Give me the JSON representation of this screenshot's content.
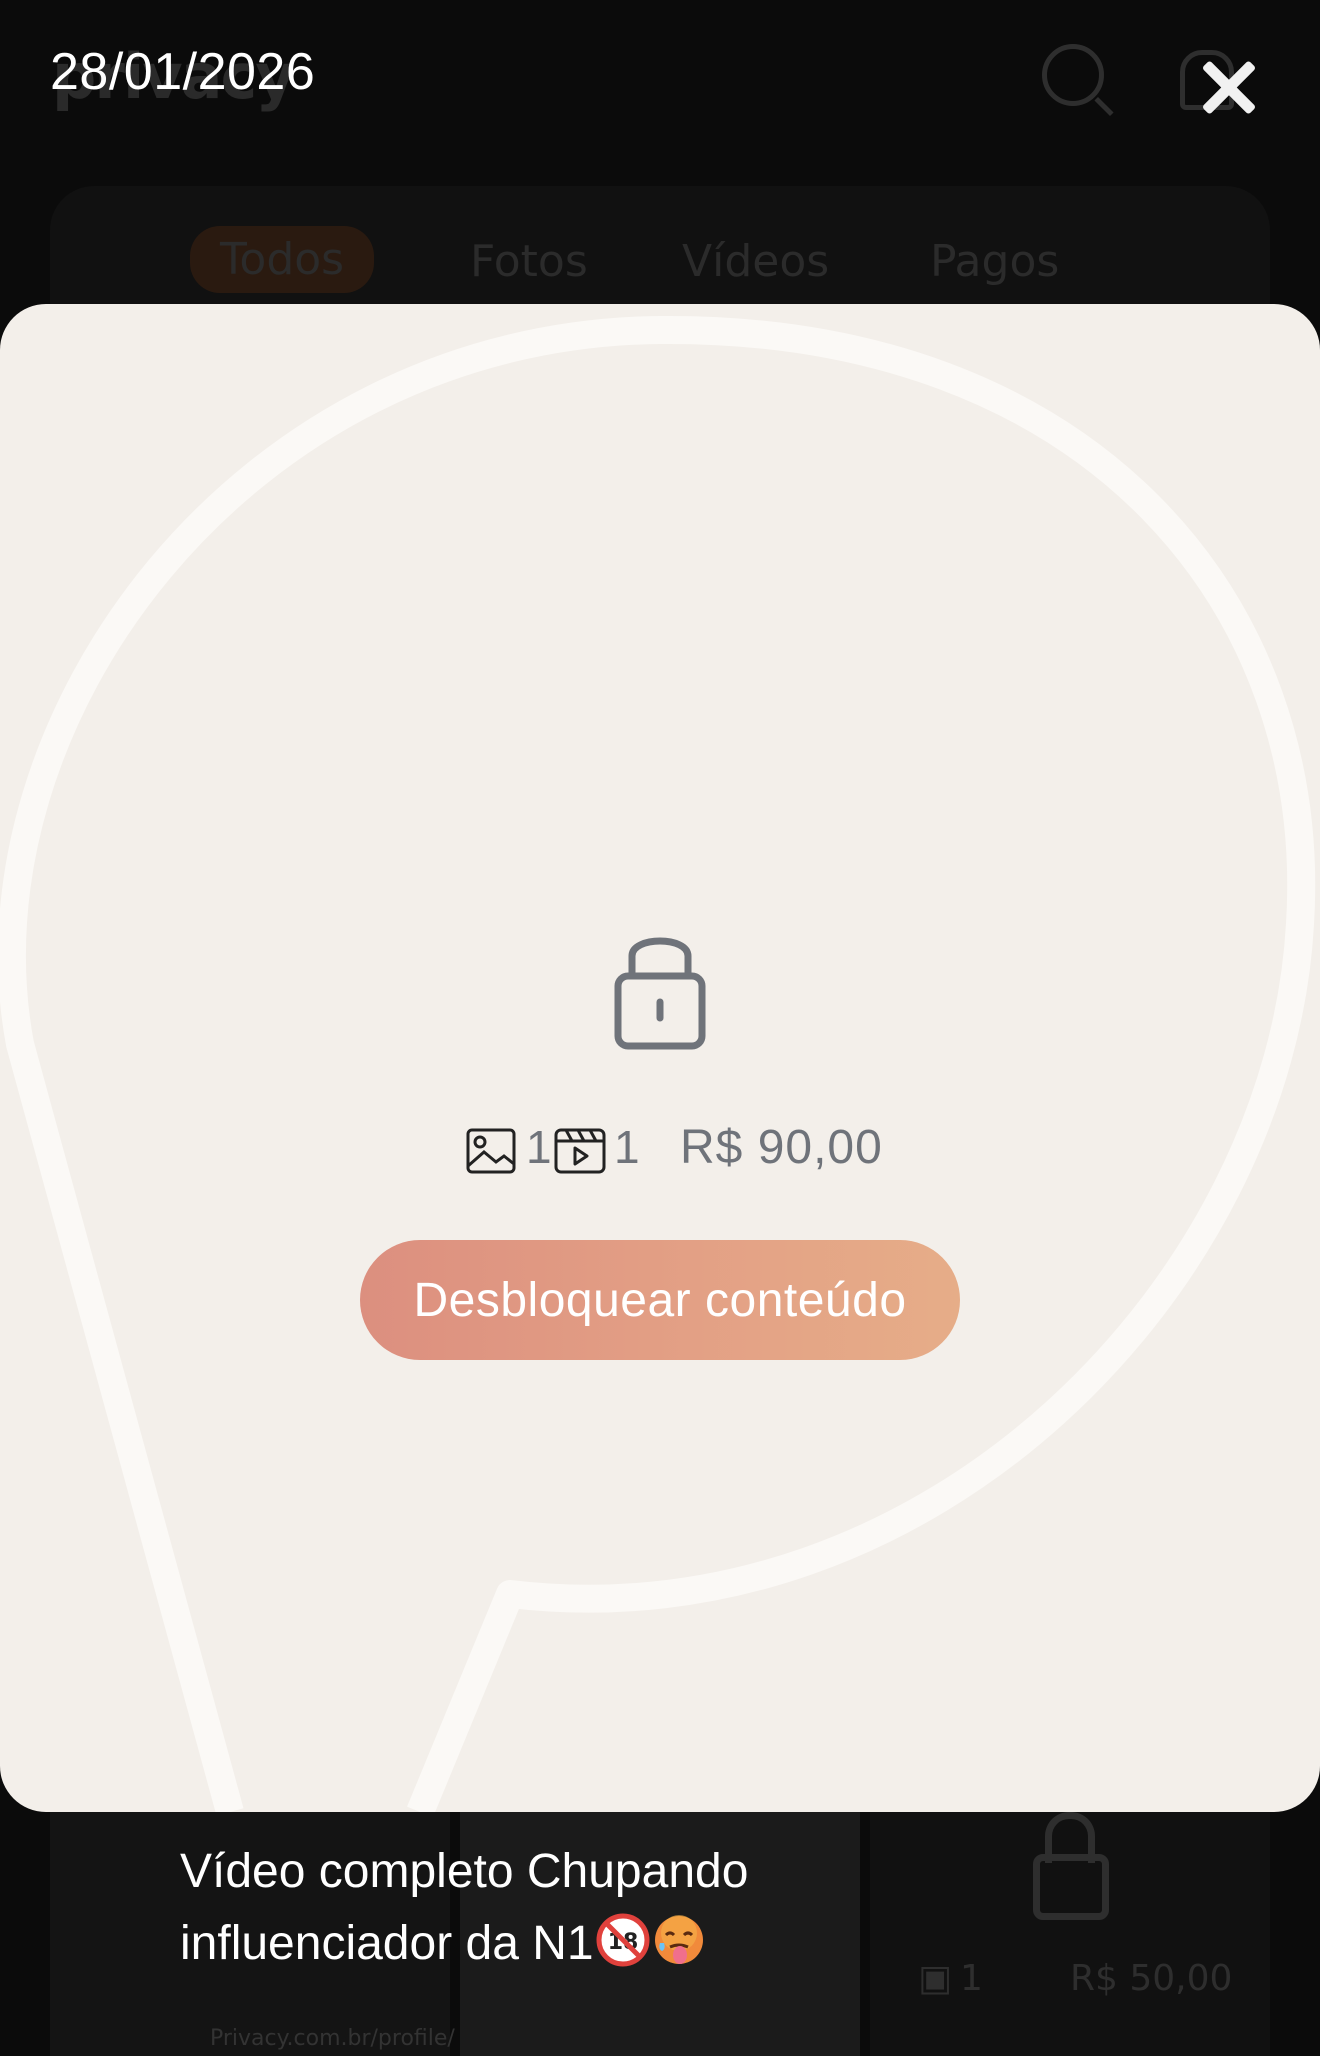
{
  "background": {
    "logo": "privacy",
    "tabs": [
      "Todos",
      "Fotos",
      "Vídeos",
      "Pagos"
    ],
    "active_tab": "Todos",
    "card_video_count": "1",
    "card_price": "R$ 50,00",
    "url_fragment": "Privacy.com.br/profile/"
  },
  "header": {
    "date": "28/01/2026",
    "close_icon": "close-icon"
  },
  "post": {
    "lock_icon": "lock-icon",
    "image_count": "1",
    "video_count": "1",
    "price": "R$ 90,00",
    "unlock_label": "Desbloquear conteúdo",
    "caption_line1": "Vídeo completo Chupando",
    "caption_line2": "influenciador da N1",
    "caption_emojis": [
      "no-under-18-emoji",
      "hot-face-emoji"
    ]
  },
  "colors": {
    "card_bg": "#f3efea",
    "accent_start": "#dc8f7f",
    "accent_end": "#e6ad88",
    "meta_text": "#6f737a"
  }
}
